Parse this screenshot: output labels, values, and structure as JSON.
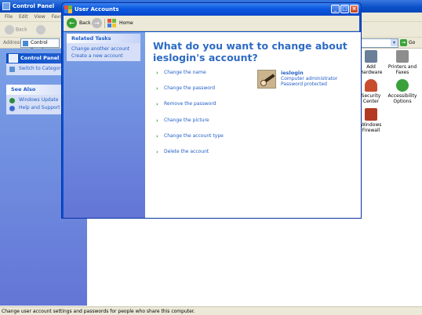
{
  "control_panel": {
    "title": "Control Panel",
    "menu": [
      "File",
      "Edit",
      "View",
      "Favo"
    ],
    "back_label": "Back",
    "address_label": "Address",
    "address_value": "Control Panel",
    "go_label": "Go",
    "panel_header": "Control Panel",
    "switch_label": "Switch to Category",
    "see_also_header": "See Also",
    "see_also": [
      "Windows Update",
      "Help and Support"
    ],
    "icons": [
      {
        "label": "Add Hardware",
        "icon": "add-hardware-icon",
        "color": "#6a7f98"
      },
      {
        "label": "Printers and Faxes",
        "icon": "printer-icon",
        "color": "#8d8d8d"
      },
      {
        "label": "Security Center",
        "icon": "security-shield-icon",
        "color": "#c84d2f"
      },
      {
        "label": "Accessibility Options",
        "icon": "accessibility-icon",
        "color": "#3aa03a"
      },
      {
        "label": "Windows Firewall",
        "icon": "firewall-icon",
        "color": "#b33a22"
      }
    ]
  },
  "status_text": "Change user account settings and passwords for people who share this computer.",
  "user_accounts": {
    "title": "User Accounts",
    "toolbar": {
      "back": "Back",
      "home": "Home"
    },
    "related_tasks_header": "Related Tasks",
    "related_tasks": [
      "Change another account",
      "Create a new account"
    ],
    "heading": "What do you want to change about ieslogin's account?",
    "tasks": [
      "Change the name",
      "Change the password",
      "Remove the password",
      "Change the picture",
      "Change the account type",
      "Delete the account"
    ],
    "user": {
      "name": "ieslogin",
      "role": "Computer administrator",
      "status": "Password protected"
    }
  },
  "colors": {
    "title_bar": "#0a58e0",
    "task_pane": "#7ba2e7",
    "link": "#215dc6",
    "heading": "#2e6bc4"
  }
}
